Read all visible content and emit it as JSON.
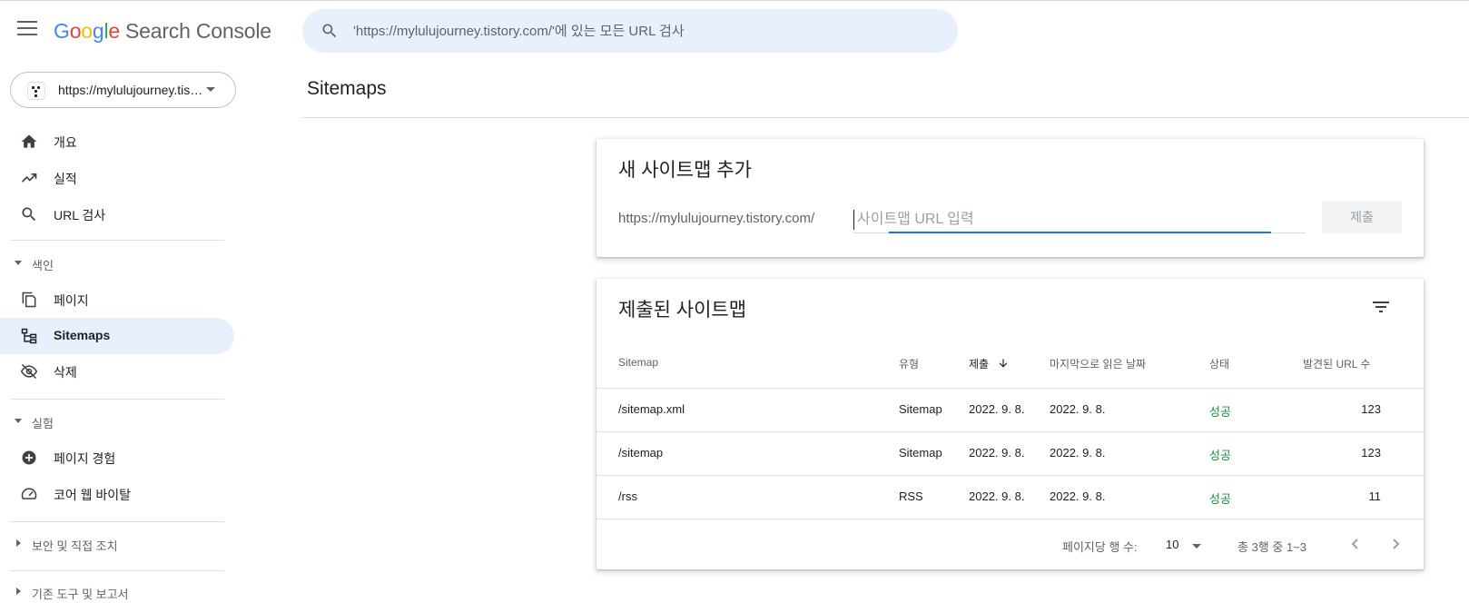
{
  "app": {
    "product_name": "Search Console",
    "logo_letters": [
      "G",
      "o",
      "o",
      "g",
      "l",
      "e"
    ]
  },
  "search": {
    "placeholder": "'https://mylulujourney.tistory.com/'에 있는 모든 URL 검사"
  },
  "property": {
    "label": "https://mylulujourney.tistory.com/"
  },
  "sidebar": {
    "items_top": [
      {
        "label": "개요",
        "icon": "home-icon"
      },
      {
        "label": "실적",
        "icon": "trending-up-icon"
      },
      {
        "label": "URL 검사",
        "icon": "search-icon"
      }
    ],
    "sections": [
      {
        "label": "색인",
        "expanded": true,
        "items": [
          {
            "label": "페이지",
            "icon": "pages-icon"
          },
          {
            "label": "Sitemaps",
            "icon": "sitemap-icon",
            "active": true
          },
          {
            "label": "삭제",
            "icon": "visibility-off-icon"
          }
        ]
      },
      {
        "label": "실험",
        "expanded": true,
        "items": [
          {
            "label": "페이지 경험",
            "icon": "add-circle-icon"
          },
          {
            "label": "코어 웹 바이탈",
            "icon": "speed-gauge-icon"
          }
        ]
      },
      {
        "label": "보안 및 직접 조치",
        "expanded": false,
        "items": []
      },
      {
        "label": "기존 도구 및 보고서",
        "expanded": false,
        "items": []
      }
    ]
  },
  "page": {
    "title": "Sitemaps"
  },
  "add_card": {
    "title": "새 사이트맵 추가",
    "prefix": "https://mylulujourney.tistory.com/",
    "placeholder": "사이트맵 URL 입력",
    "submit_label": "제출"
  },
  "submitted_card": {
    "title": "제출된 사이트맵",
    "columns": [
      "Sitemap",
      "유형",
      "제출",
      "마지막으로 읽은 날짜",
      "상태",
      "발견된 URL 수"
    ],
    "sorted_column": "제출",
    "rows": [
      {
        "sitemap": "/sitemap.xml",
        "type": "Sitemap",
        "submitted": "2022. 9. 8.",
        "last_read": "2022. 9. 8.",
        "status": "성공",
        "urls": "123"
      },
      {
        "sitemap": "/sitemap",
        "type": "Sitemap",
        "submitted": "2022. 9. 8.",
        "last_read": "2022. 9. 8.",
        "status": "성공",
        "urls": "123"
      },
      {
        "sitemap": "/rss",
        "type": "RSS",
        "submitted": "2022. 9. 8.",
        "last_read": "2022. 9. 8.",
        "status": "성공",
        "urls": "11"
      }
    ],
    "pagination": {
      "rows_per_page_label": "페이지당 행 수:",
      "rows_per_page": "10",
      "range": "총 3행 중 1~3"
    }
  },
  "colors": {
    "accent": "#1a73e8",
    "active_bg": "#e8f0fe",
    "success": "#1e8e3e"
  }
}
